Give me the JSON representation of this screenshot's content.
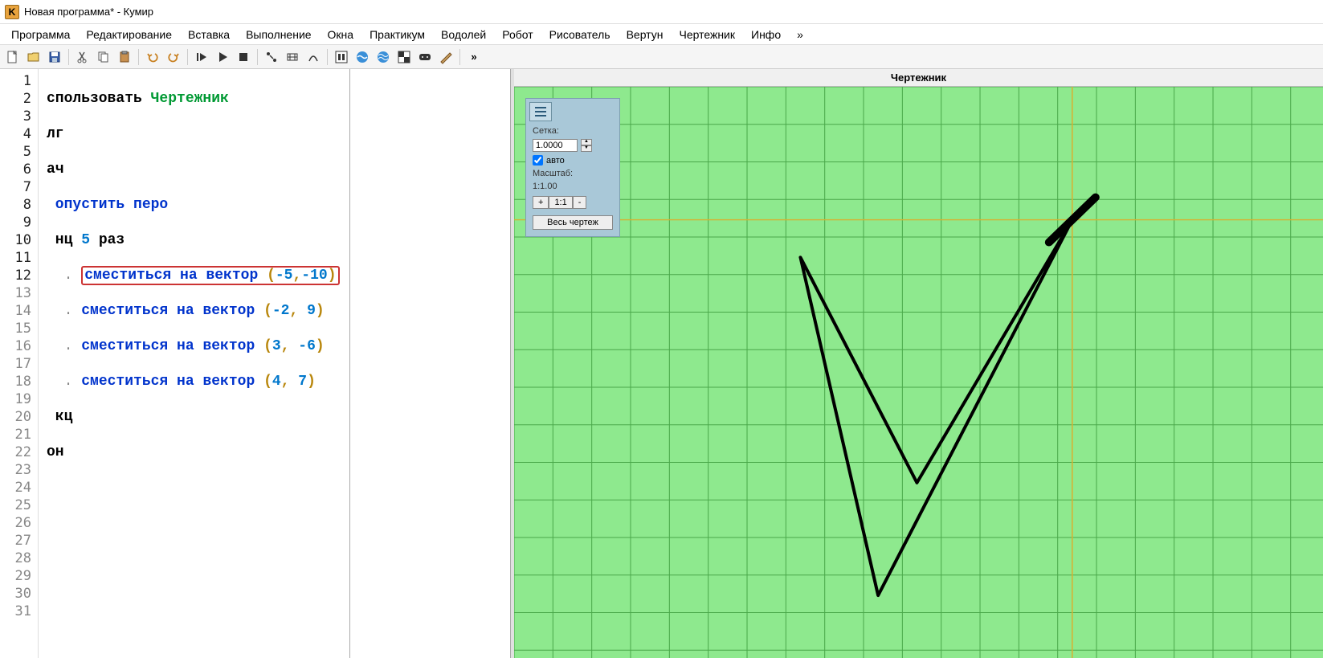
{
  "app_icon_letter": "K",
  "window_title": "Новая программа* - Кумир",
  "menu": [
    "Программа",
    "Редактирование",
    "Вставка",
    "Выполнение",
    "Окна",
    "Практикум",
    "Водолей",
    "Робот",
    "Рисователь",
    "Вертун",
    "Чертежник",
    "Инфо",
    "»"
  ],
  "toolbar_more": "»",
  "gutter": {
    "max": 31,
    "used_lines": 12
  },
  "code": {
    "l1_a": "спользовать ",
    "l1_b": "Чертежник",
    "l2": "лг",
    "l3": "ач",
    "l4": " опустить перо",
    "l5_a": " нц ",
    "l5_b": "5",
    "l5_c": " раз",
    "l6_a": ". ",
    "l6_b": "сместиться на вектор ",
    "l6_c": "(",
    "l6_d": "-5",
    "l6_e": ",",
    "l6_f": "-10",
    "l6_g": ")",
    "l7_a": ". ",
    "l7_b": "сместиться на вектор ",
    "l7_c": "(",
    "l7_d": "-2",
    "l7_e": ", ",
    "l7_f": "9",
    "l7_g": ")",
    "l8_a": ". ",
    "l8_b": "сместиться на вектор ",
    "l8_c": "(",
    "l8_d": "3",
    "l8_e": ", ",
    "l8_f": "-6",
    "l8_g": ")",
    "l9_a": ". ",
    "l9_b": "сместиться на вектор ",
    "l9_c": "(",
    "l9_d": "4",
    "l9_e": ", ",
    "l9_f": "7",
    "l9_g": ")",
    "l10": " кц",
    "l11": "он"
  },
  "right_title": "Чертежник",
  "panel": {
    "grid_label": "Сетка:",
    "grid_value": "1.0000",
    "auto_label": "авто",
    "auto_checked": true,
    "scale_label": "Масштаб:",
    "scale_value": "1:1.00",
    "zoom_plus": "+",
    "zoom_one": "1:1",
    "zoom_minus": "-",
    "full_drawing": "Весь чертеж"
  },
  "chart_data": {
    "type": "line",
    "title": "Чертежник",
    "grid_step": 1,
    "origin_approx": [
      5,
      4
    ],
    "pen_start": [
      0,
      0
    ],
    "loop_count": 5,
    "vectors_per_iteration": [
      [
        -5,
        -10
      ],
      [
        -2,
        9
      ],
      [
        3,
        -6
      ],
      [
        4,
        7
      ]
    ],
    "points": [
      [
        0,
        0
      ],
      [
        -5,
        -10
      ],
      [
        -7,
        -1
      ],
      [
        -4,
        -7
      ],
      [
        0,
        0
      ],
      [
        -5,
        -10
      ],
      [
        -7,
        -1
      ],
      [
        -4,
        -7
      ],
      [
        0,
        0
      ],
      [
        -5,
        -10
      ],
      [
        -7,
        -1
      ],
      [
        -4,
        -7
      ],
      [
        0,
        0
      ],
      [
        -5,
        -10
      ],
      [
        -7,
        -1
      ],
      [
        -4,
        -7
      ],
      [
        0,
        0
      ],
      [
        -5,
        -10
      ],
      [
        -7,
        -1
      ],
      [
        -4,
        -7
      ],
      [
        0,
        0
      ]
    ]
  }
}
